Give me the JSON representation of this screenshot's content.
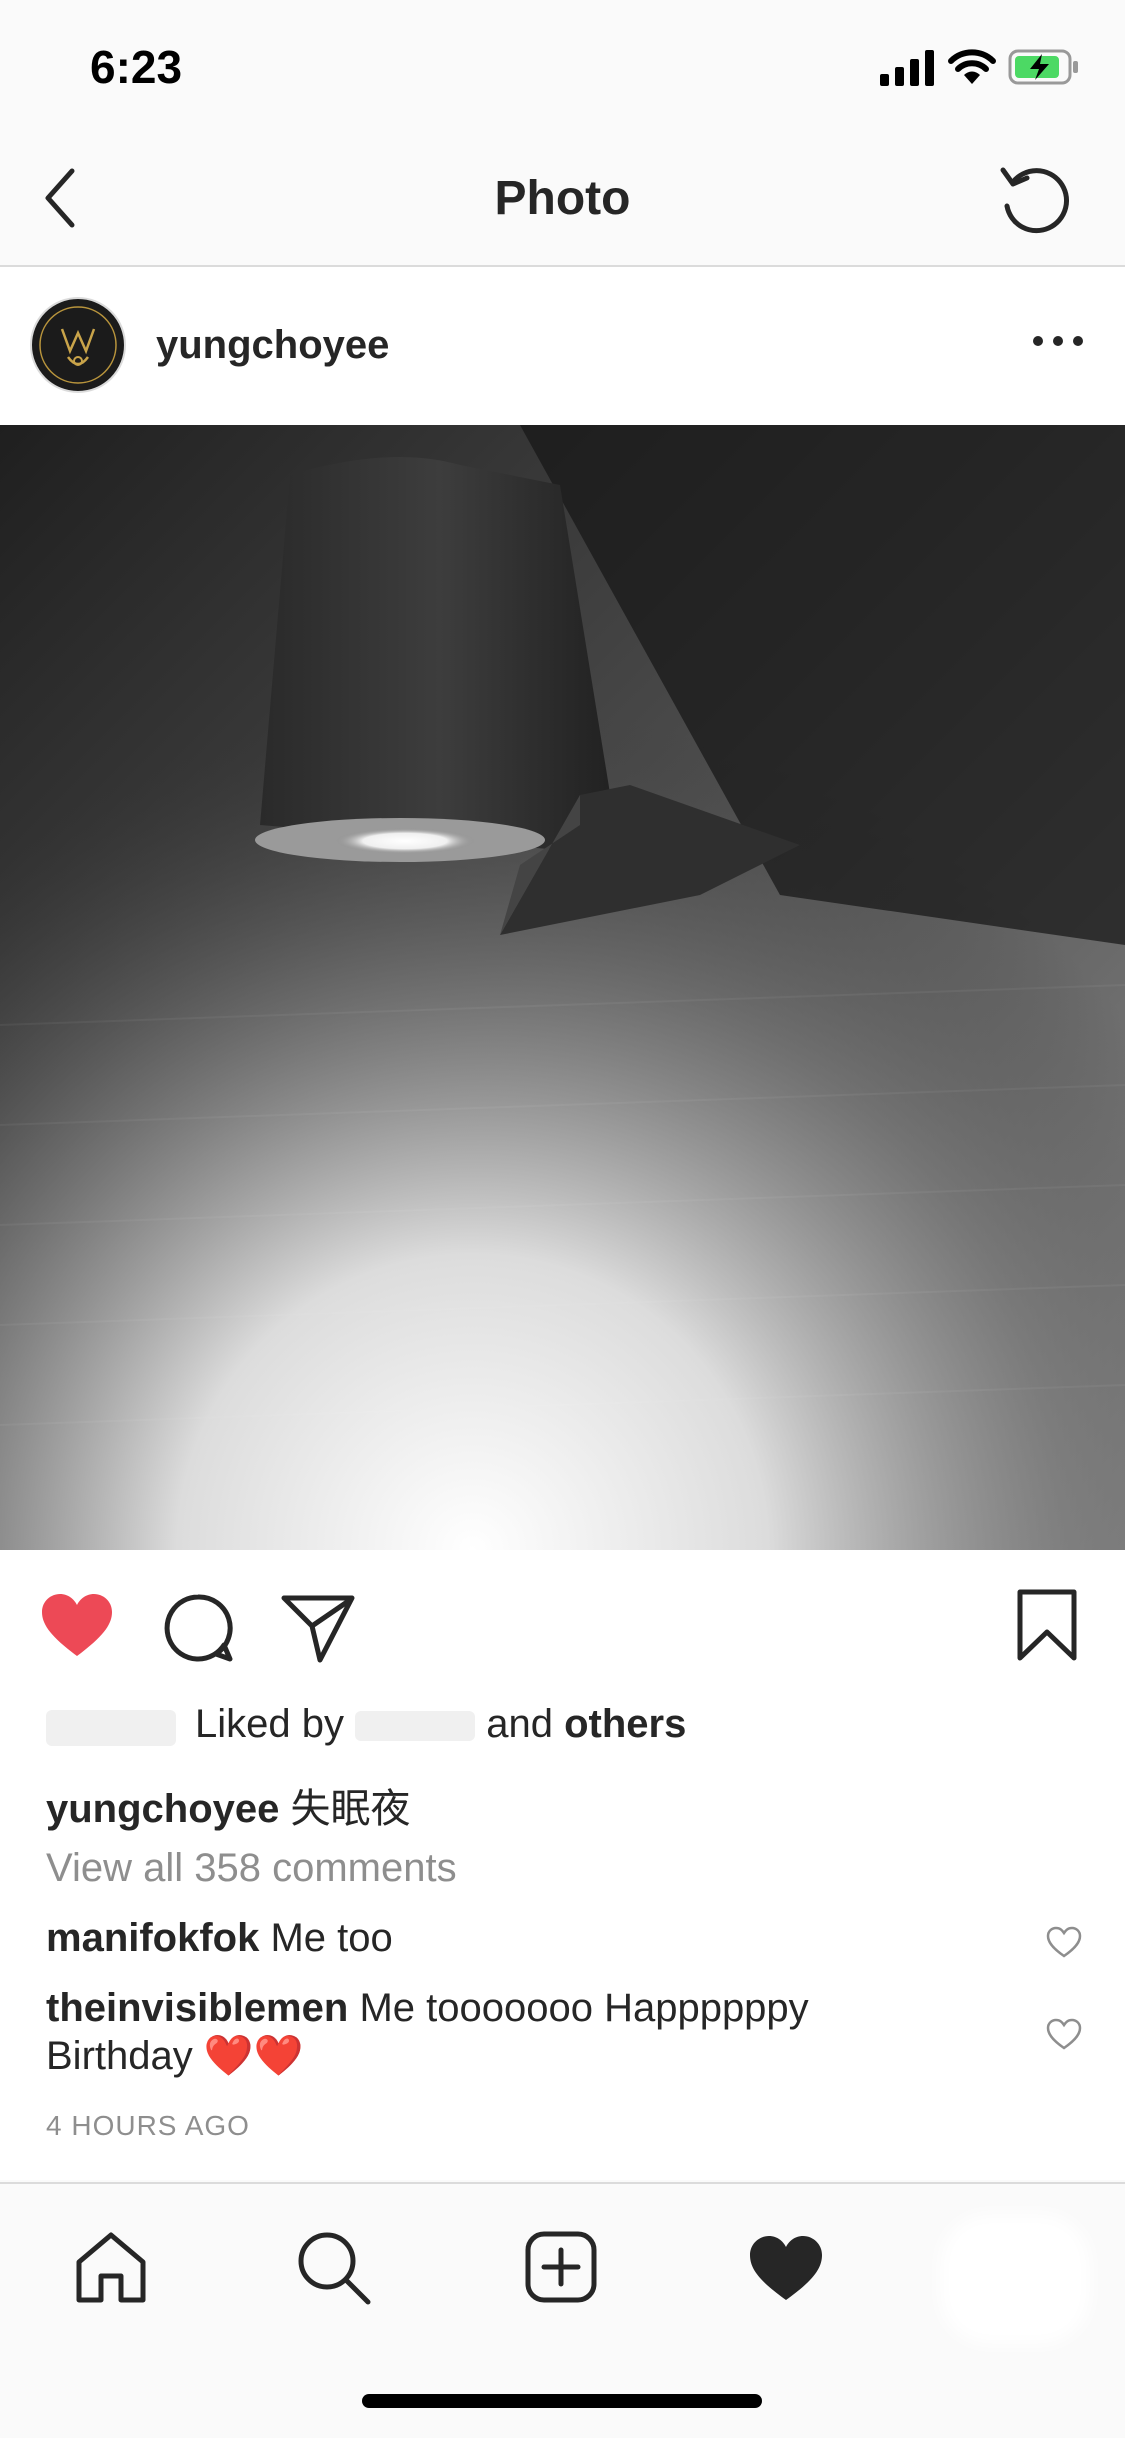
{
  "status_bar": {
    "time": "6:23"
  },
  "nav": {
    "title": "Photo"
  },
  "post": {
    "username": "yungchoyee",
    "photo_alt": "black and white photo of a wall lamp casting light on textured wallpaper"
  },
  "likes": {
    "prefix": "Liked by",
    "middle": "and",
    "others": "others"
  },
  "caption": {
    "username": "yungchoyee",
    "text": "失眠夜"
  },
  "view_all_comments": "View all 358 comments",
  "comments": [
    {
      "username": "manifokfok",
      "text": "Me too"
    },
    {
      "username": "theinvisiblemen",
      "text": "Me tooooooo Happppppy Birthday ❤️❤️"
    }
  ],
  "timestamp": "4 HOURS AGO",
  "colors": {
    "like_red": "#ed4956",
    "text": "#262626",
    "muted": "#8e8e8e"
  }
}
